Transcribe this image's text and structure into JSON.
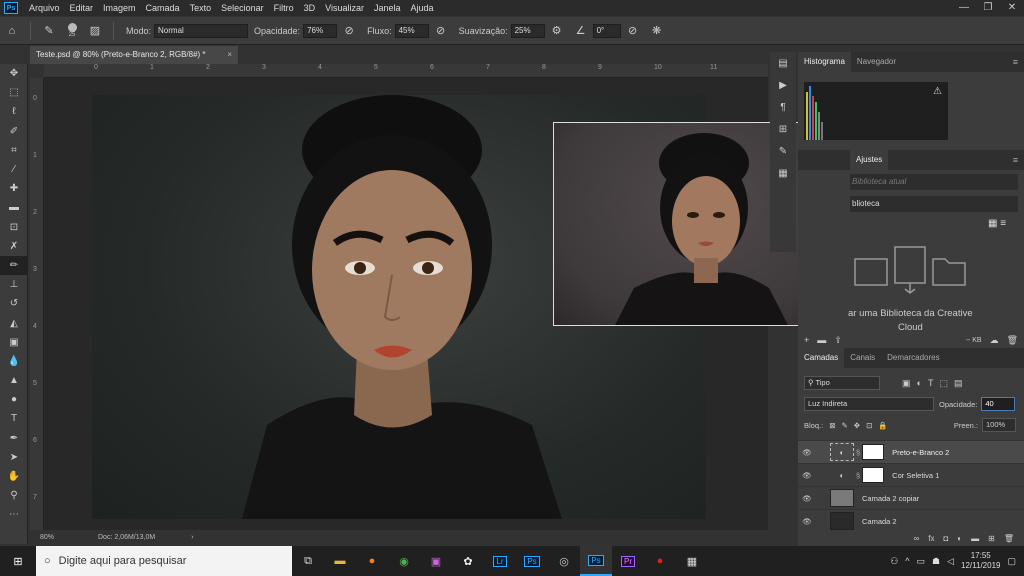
{
  "app_icon_label": "Ps",
  "menu": [
    "Arquivo",
    "Editar",
    "Imagem",
    "Camada",
    "Texto",
    "Selecionar",
    "Filtro",
    "3D",
    "Visualizar",
    "Janela",
    "Ajuda"
  ],
  "window_controls": [
    "—",
    "❐",
    "✕"
  ],
  "options_bar": {
    "brush_size": "25",
    "mode_label": "Modo:",
    "mode_value": "Normal",
    "opacity_label": "Opacidade:",
    "opacity_value": "76%",
    "flow_label": "Fluxo:",
    "flow_value": "45%",
    "smoothing_label": "Suavização:",
    "smoothing_value": "25%",
    "angle_value": "0°"
  },
  "document": {
    "tab_title": "Teste.psd @ 80% (Preto-e-Branco 2, RGB/8#) *",
    "tab_close": "×",
    "zoom": "80%",
    "doc_info": "Doc: 2,06M/13,0M",
    "h_ruler_ticks": [
      "0",
      "1",
      "2",
      "3",
      "4",
      "5",
      "6",
      "7",
      "8",
      "9",
      "10",
      "11"
    ],
    "v_ruler_ticks": [
      "0",
      "1",
      "2",
      "3",
      "4",
      "5",
      "6",
      "7"
    ]
  },
  "tools": [
    "move",
    "marquee",
    "lasso",
    "quick-select",
    "crop",
    "eyedropper",
    "healing",
    "brush",
    "stamp",
    "history-brush",
    "eraser",
    "gradient",
    "blur",
    "dodge",
    "pen",
    "type",
    "path-select",
    "shape",
    "hand",
    "zoom",
    "more"
  ],
  "panels": {
    "top_tabs": [
      "Histograma",
      "Navegador"
    ],
    "warning_icon": "⚠",
    "libraries_tabs": [
      "Ajustes"
    ],
    "libraries_search_placeholder": "Biblioteca atual",
    "libraries_selected": "blioteca",
    "libraries_caption": "ar uma Biblioteca da Creative",
    "libraries_caption2": "Cloud",
    "libraries_size": "-- KB",
    "layers_tabs": [
      "Camadas",
      "Canais",
      "Demarcadores"
    ],
    "filter_kind": "Tipo",
    "blend_mode": "Luz Indireta",
    "opacity_label": "Opacidade:",
    "opacity_value": "40",
    "lock_label": "Bloq.:",
    "fill_label": "Preen.:",
    "fill_value": "100%",
    "layers": [
      {
        "name": "Preto-e-Branco 2",
        "selected": true
      },
      {
        "name": "Cor Seletiva 1",
        "selected": false
      },
      {
        "name": "Camada 2 copiar",
        "selected": false
      },
      {
        "name": "Camada 2",
        "selected": false
      }
    ]
  },
  "taskbar": {
    "search_placeholder": "Digite aqui para pesquisar",
    "apps": [
      "Lr",
      "Ps",
      "Pr"
    ],
    "time": "17:55",
    "date": "12/11/2019"
  },
  "colors": {
    "accent": "#31a8ff",
    "menubar": "#2b2b2b",
    "panel": "#3c3c3c",
    "canvas_bg": "#282828"
  }
}
